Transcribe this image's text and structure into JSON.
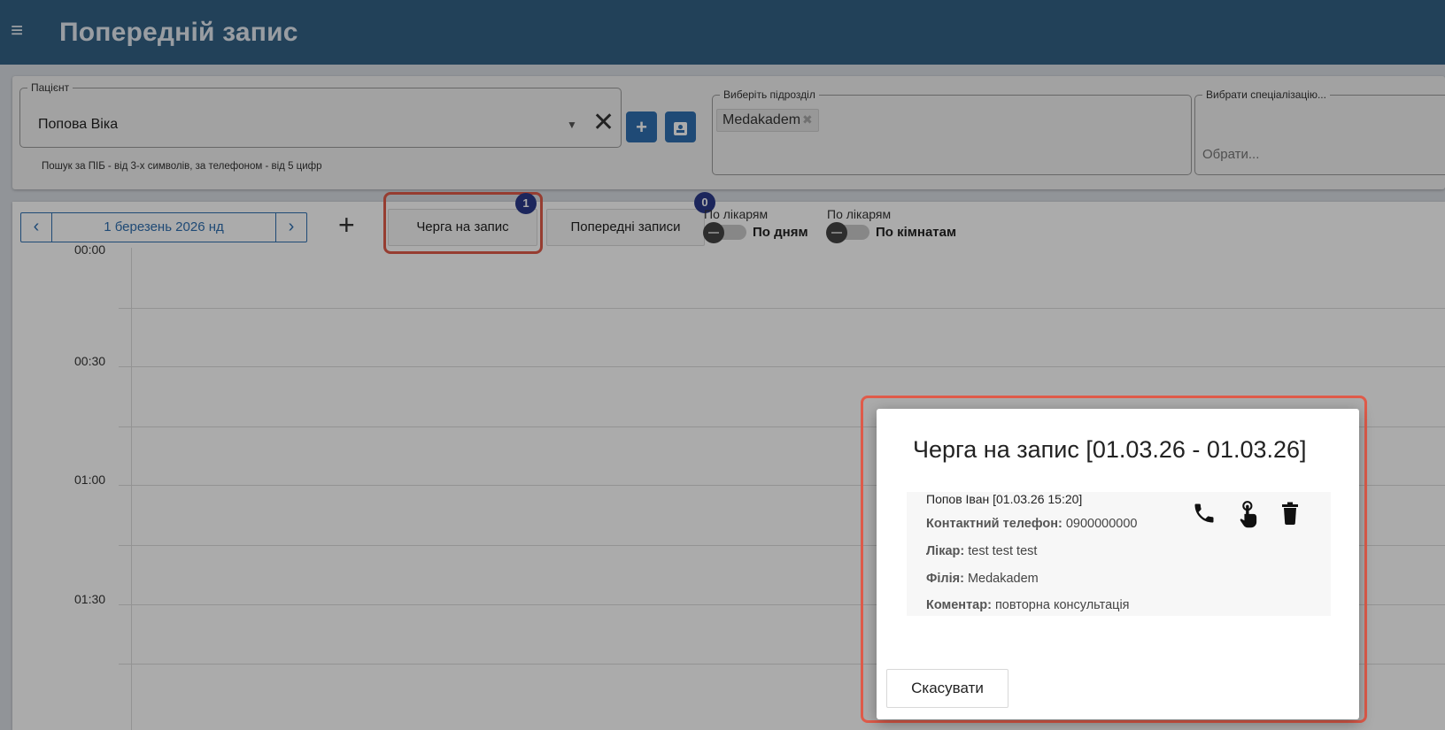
{
  "header": {
    "menu_icon": "hamburger-menu-icon",
    "title": "Попередній запис"
  },
  "filters": {
    "patient": {
      "legend": "Пацієнт",
      "value": "Попова Віка",
      "hint": "Пошук за ПІБ - від 3-х символів, за телефоном - від 5 цифр"
    },
    "branch": {
      "legend": "Виберіть підрозділ",
      "chips": [
        "Medakadem"
      ]
    },
    "specialization": {
      "legend": "Вибрати спеціалізацію...",
      "placeholder": "Обрати..."
    }
  },
  "calendar": {
    "date_label": "1 березень 2026 нд",
    "tabs": [
      {
        "label": "Черга на запис",
        "badge": "1"
      },
      {
        "label": "Попередні записи",
        "badge": "0"
      }
    ],
    "toggles": [
      {
        "top": "По лікарям",
        "label": "По дням"
      },
      {
        "top": "По лікарям",
        "label": "По кімнатам"
      }
    ],
    "time_slots": [
      "00:00",
      "00:30",
      "01:00",
      "01:30"
    ]
  },
  "modal": {
    "title": "Черга на запис [01.03.26 - 01.03.26]",
    "entry": {
      "name": "Попов Іван [01.03.26 15:20]",
      "phone_label": "Контактний телефон:",
      "phone": "0900000000",
      "doctor_label": "Лікар:",
      "doctor": "test test test",
      "branch_label": "Філія:",
      "branch": "Medakadem",
      "comment_label": "Коментар:",
      "comment": "повторна консультація"
    },
    "cancel_label": "Скасувати"
  },
  "colors": {
    "header": "#336185",
    "accent": "#2f6fb0",
    "badge": "#2b3a8a",
    "highlight": "#e05b4a"
  }
}
